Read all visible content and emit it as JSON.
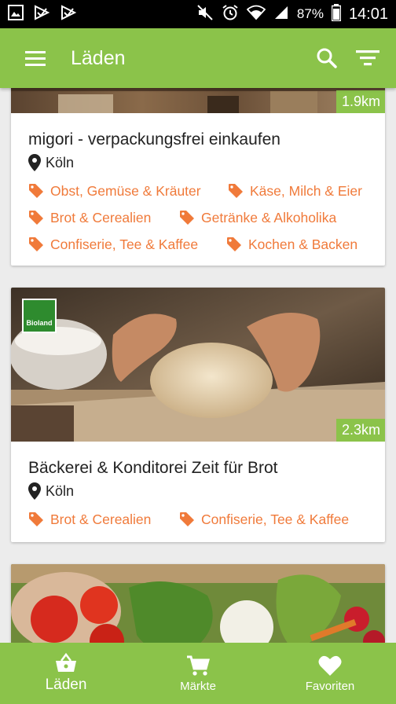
{
  "status_bar": {
    "battery": "87%",
    "time": "14:01"
  },
  "app_bar": {
    "title": "Läden"
  },
  "stores": [
    {
      "name": "migori - verpackungsfrei einkaufen",
      "city": "Köln",
      "distance": "1.9km",
      "tags": [
        "Obst, Gemüse & Kräuter",
        "Käse, Milch & Eier",
        "Brot & Cerealien",
        "Getränke & Alkoholika",
        "Confiserie, Tee & Kaffee",
        "Kochen & Backen"
      ]
    },
    {
      "name": "Bäckerei & Konditorei Zeit für Brot",
      "city": "Köln",
      "distance": "2.3km",
      "badge": "Bioland",
      "tags": [
        "Brot & Cerealien",
        "Confiserie, Tee & Kaffee"
      ]
    }
  ],
  "bottom_nav": {
    "items": [
      {
        "label": "Läden"
      },
      {
        "label": "Märkte"
      },
      {
        "label": "Favoriten"
      }
    ]
  },
  "colors": {
    "primary": "#8bc34a",
    "tag": "#f07a3a",
    "background": "#ececec"
  }
}
